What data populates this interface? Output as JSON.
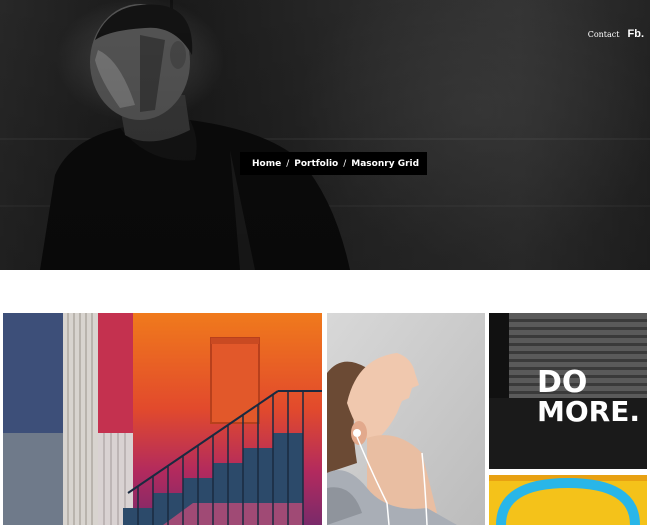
{
  "header": {
    "nav": {
      "contact": "Contact",
      "fb": "Fb."
    }
  },
  "breadcrumb": {
    "home": "Home",
    "portfolio": "Portfolio",
    "current": "Masonry Grid",
    "separator": "/"
  },
  "grid": {
    "domore_line1": "DO",
    "domore_line2": "MORE."
  },
  "colors": {
    "breadcrumb_bg": "#000000",
    "hero_dark": "#1f1f1f",
    "accent_orange": "#e8641e",
    "accent_cyan": "#29b6e8",
    "accent_yellow": "#f4c21a"
  }
}
